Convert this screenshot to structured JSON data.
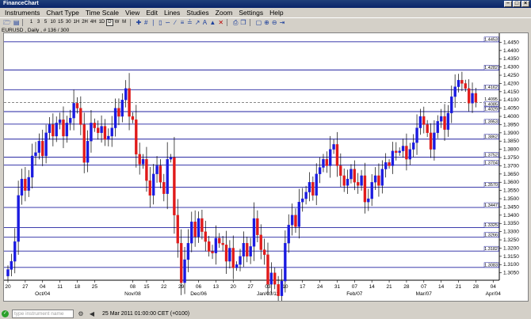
{
  "window": {
    "title": "FinanceChart"
  },
  "menu": [
    "Instruments",
    "Chart Type",
    "Time Scale",
    "View",
    "Edit",
    "Lines",
    "Studies",
    "Zoom",
    "Settings",
    "Help"
  ],
  "toolbar": {
    "timescale_buttons": [
      "1",
      "3",
      "5",
      "10",
      "15",
      "30",
      "1H",
      "2H",
      "4H",
      "1D",
      "W",
      "M"
    ],
    "selected": "D"
  },
  "chart_info": "EURUSD , Daily , # 136 / 300",
  "status": {
    "input_placeholder": "type instrument name",
    "datetime": "25 Mar 2011 01:00:00 CET (+0100)"
  },
  "chart_data": {
    "type": "candlestick",
    "instrument": "EURUSD",
    "timeframe": "Daily",
    "ylim": [
      1.3005,
      1.4505
    ],
    "y_ticks": [
      1.305,
      1.31,
      1.315,
      1.32,
      1.325,
      1.33,
      1.335,
      1.34,
      1.345,
      1.35,
      1.355,
      1.36,
      1.365,
      1.37,
      1.375,
      1.38,
      1.385,
      1.39,
      1.395,
      1.4,
      1.405,
      1.41,
      1.415,
      1.42,
      1.425,
      1.43,
      1.435,
      1.44,
      1.445
    ],
    "x_ticks": [
      {
        "i": 0,
        "label": "20"
      },
      {
        "i": 5,
        "label": "27"
      },
      {
        "i": 10,
        "label": "04",
        "sub": "Oct/04"
      },
      {
        "i": 15,
        "label": "11"
      },
      {
        "i": 20,
        "label": "18"
      },
      {
        "i": 25,
        "label": "25"
      },
      {
        "i": 36,
        "label": "08",
        "sub": "Nov/08"
      },
      {
        "i": 40,
        "label": "15"
      },
      {
        "i": 45,
        "label": "22"
      },
      {
        "i": 50,
        "label": "29"
      },
      {
        "i": 55,
        "label": "06",
        "sub": "Dec/06"
      },
      {
        "i": 60,
        "label": "13"
      },
      {
        "i": 65,
        "label": "20"
      },
      {
        "i": 70,
        "label": "27"
      },
      {
        "i": 75,
        "label": "03",
        "sub": "Jan/03/11"
      },
      {
        "i": 80,
        "label": "10"
      },
      {
        "i": 85,
        "label": "17"
      },
      {
        "i": 90,
        "label": "24"
      },
      {
        "i": 95,
        "label": "31"
      },
      {
        "i": 100,
        "label": "07",
        "sub": "Feb/07"
      },
      {
        "i": 105,
        "label": "14"
      },
      {
        "i": 110,
        "label": "21"
      },
      {
        "i": 115,
        "label": "28"
      },
      {
        "i": 120,
        "label": "07",
        "sub": "Mar/07"
      },
      {
        "i": 125,
        "label": "14"
      },
      {
        "i": 130,
        "label": "21"
      },
      {
        "i": 135,
        "label": "28"
      },
      {
        "i": 140,
        "label": "04",
        "sub": "Apr/04"
      }
    ],
    "slots": 142,
    "horizontal_lines": [
      1.4453,
      1.4282,
      1.4162,
      1.4029,
      1.3953,
      1.3862,
      1.3752,
      1.3704,
      1.357,
      1.3447,
      1.3325,
      1.3266,
      1.3182,
      1.3083
    ],
    "horizontal_line_labels": [
      "1.4453",
      "1.4282",
      "1.4162",
      "1.4029",
      "1.3953",
      "1.3862",
      "1.3752",
      "1.3704",
      "1.3570",
      "1.3447",
      "1.3325",
      "1.3266",
      "1.3182",
      "1.3083"
    ],
    "current_price": 1.4085,
    "current_price_label": "1.4085",
    "current_price_ghost": 1.4095,
    "current_price_ghost_label": "1.4095",
    "close": [
      1.307,
      1.312,
      1.324,
      1.352,
      1.362,
      1.355,
      1.363,
      1.376,
      1.378,
      1.385,
      1.376,
      1.39,
      1.395,
      1.388,
      1.396,
      1.398,
      1.388,
      1.396,
      1.399,
      1.408,
      1.405,
      1.395,
      1.372,
      1.385,
      1.396,
      1.393,
      1.39,
      1.394,
      1.386,
      1.388,
      1.393,
      1.405,
      1.4,
      1.41,
      1.417,
      1.4,
      1.398,
      1.377,
      1.371,
      1.374,
      1.361,
      1.352,
      1.365,
      1.37,
      1.36,
      1.353,
      1.374,
      1.375,
      1.34,
      1.323,
      1.299,
      1.313,
      1.323,
      1.336,
      1.327,
      1.338,
      1.33,
      1.324,
      1.318,
      1.317,
      1.326,
      1.323,
      1.322,
      1.312,
      1.32,
      1.308,
      1.31,
      1.315,
      1.323,
      1.315,
      1.321,
      1.338,
      1.328,
      1.319,
      1.316,
      1.298,
      1.305,
      1.298,
      1.291,
      1.3,
      1.323,
      1.334,
      1.34,
      1.333,
      1.348,
      1.35,
      1.354,
      1.36,
      1.352,
      1.365,
      1.369,
      1.374,
      1.37,
      1.38,
      1.383,
      1.37,
      1.364,
      1.358,
      1.362,
      1.368,
      1.36,
      1.358,
      1.364,
      1.348,
      1.35,
      1.36,
      1.364,
      1.358,
      1.368,
      1.372,
      1.37,
      1.379,
      1.378,
      1.379,
      1.382,
      1.374,
      1.38,
      1.384,
      1.393,
      1.4,
      1.395,
      1.39,
      1.38,
      1.39,
      1.397,
      1.4,
      1.392,
      1.402,
      1.412,
      1.418,
      1.422,
      1.42,
      1.417,
      1.408,
      1.414,
      1.4085
    ]
  }
}
